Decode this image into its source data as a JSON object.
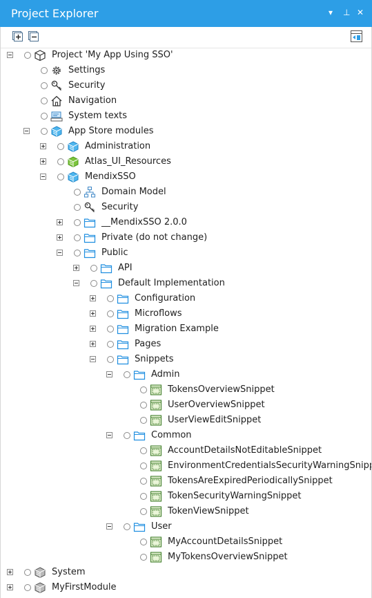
{
  "panel": {
    "title": "Project Explorer",
    "controls": {
      "dropdown": "▾",
      "pin": "⊥",
      "close": "✕"
    }
  },
  "tree": [
    {
      "label": "Project 'My App Using SSO'",
      "depth": 0,
      "expander": "minus",
      "icon": "project-cube-icon"
    },
    {
      "label": "Settings",
      "depth": 1,
      "expander": "none",
      "icon": "gear-icon"
    },
    {
      "label": "Security",
      "depth": 1,
      "expander": "none",
      "icon": "key-icon"
    },
    {
      "label": "Navigation",
      "depth": 1,
      "expander": "none",
      "icon": "home-icon"
    },
    {
      "label": "System texts",
      "depth": 1,
      "expander": "none",
      "icon": "system-texts-icon"
    },
    {
      "label": "App Store modules",
      "depth": 1,
      "expander": "minus",
      "icon": "appstore-module-icon"
    },
    {
      "label": "Administration",
      "depth": 2,
      "expander": "plus",
      "icon": "module-blue-icon"
    },
    {
      "label": "Atlas_UI_Resources",
      "depth": 2,
      "expander": "plus",
      "icon": "module-green-icon"
    },
    {
      "label": "MendixSSO",
      "depth": 2,
      "expander": "minus",
      "icon": "module-blue-icon"
    },
    {
      "label": "Domain Model",
      "depth": 3,
      "expander": "none",
      "icon": "domain-model-icon"
    },
    {
      "label": "Security",
      "depth": 3,
      "expander": "none",
      "icon": "key-icon"
    },
    {
      "label": "__MendixSSO 2.0.0",
      "depth": 3,
      "expander": "plus",
      "icon": "folder-icon"
    },
    {
      "label": "Private (do not change)",
      "depth": 3,
      "expander": "plus",
      "icon": "folder-icon"
    },
    {
      "label": "Public",
      "depth": 3,
      "expander": "minus",
      "icon": "folder-icon"
    },
    {
      "label": "API",
      "depth": 4,
      "expander": "plus",
      "icon": "folder-icon"
    },
    {
      "label": "Default Implementation",
      "depth": 4,
      "expander": "minus",
      "icon": "folder-icon"
    },
    {
      "label": "Configuration",
      "depth": 5,
      "expander": "plus",
      "icon": "folder-icon"
    },
    {
      "label": "Microflows",
      "depth": 5,
      "expander": "plus",
      "icon": "folder-icon"
    },
    {
      "label": "Migration Example",
      "depth": 5,
      "expander": "plus",
      "icon": "folder-icon"
    },
    {
      "label": "Pages",
      "depth": 5,
      "expander": "plus",
      "icon": "folder-icon"
    },
    {
      "label": "Snippets",
      "depth": 5,
      "expander": "minus",
      "icon": "folder-icon"
    },
    {
      "label": "Admin",
      "depth": 6,
      "expander": "minus",
      "icon": "folder-icon"
    },
    {
      "label": "TokensOverviewSnippet",
      "depth": 7,
      "expander": "none",
      "icon": "snippet-icon"
    },
    {
      "label": "UserOverviewSnippet",
      "depth": 7,
      "expander": "none",
      "icon": "snippet-icon"
    },
    {
      "label": "UserViewEditSnippet",
      "depth": 7,
      "expander": "none",
      "icon": "snippet-icon"
    },
    {
      "label": "Common",
      "depth": 6,
      "expander": "minus",
      "icon": "folder-icon"
    },
    {
      "label": "AccountDetailsNotEditableSnippet",
      "depth": 7,
      "expander": "none",
      "icon": "snippet-icon"
    },
    {
      "label": "EnvironmentCredentialsSecurityWarningSnippet",
      "depth": 7,
      "expander": "none",
      "icon": "snippet-icon"
    },
    {
      "label": "TokensAreExpiredPeriodicallySnippet",
      "depth": 7,
      "expander": "none",
      "icon": "snippet-icon"
    },
    {
      "label": "TokenSecurityWarningSnippet",
      "depth": 7,
      "expander": "none",
      "icon": "snippet-icon"
    },
    {
      "label": "TokenViewSnippet",
      "depth": 7,
      "expander": "none",
      "icon": "snippet-icon"
    },
    {
      "label": "User",
      "depth": 6,
      "expander": "minus",
      "icon": "folder-icon"
    },
    {
      "label": "MyAccountDetailsSnippet",
      "depth": 7,
      "expander": "none",
      "icon": "snippet-icon"
    },
    {
      "label": "MyTokensOverviewSnippet",
      "depth": 7,
      "expander": "none",
      "icon": "snippet-icon"
    },
    {
      "label": "System",
      "depth": 0,
      "expander": "plus",
      "icon": "module-gray-icon"
    },
    {
      "label": "MyFirstModule",
      "depth": 0,
      "expander": "plus",
      "icon": "module-gray-icon"
    }
  ]
}
